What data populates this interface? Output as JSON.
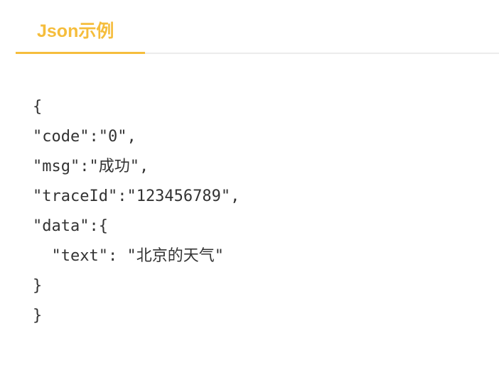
{
  "tab": {
    "label": "Json示例"
  },
  "code": {
    "lines": [
      "{",
      "\"code\":\"0\",",
      "\"msg\":\"成功\",",
      "\"traceId\":\"123456789\",",
      "\"data\":{",
      "  \"text\": \"北京的天气\"",
      "}",
      "}"
    ]
  }
}
